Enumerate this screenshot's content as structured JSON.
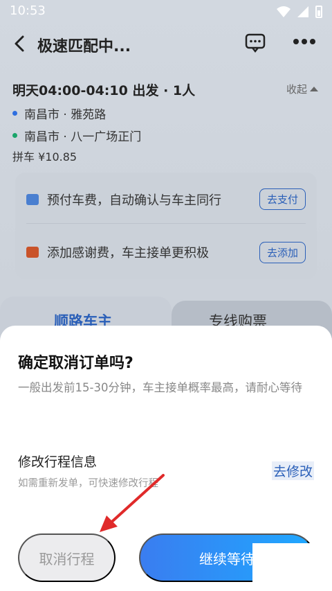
{
  "status": {
    "time": "10:53"
  },
  "nav": {
    "title": "极速匹配中..."
  },
  "trip": {
    "time_text": "明天04:00-04:10 出发 · 1人",
    "collapse_label": "收起",
    "origin": "南昌市 · 雅苑路",
    "destination": "南昌市 · 八一广场正门",
    "price": "拼车   ¥10.85"
  },
  "card": {
    "prepay_text": "预付车费，自动确认与车主同行",
    "prepay_button": "去支付",
    "tip_text": "添加感谢费，车主接单更积极",
    "tip_button": "去添加"
  },
  "tabs": {
    "active": "顺路车主",
    "other": "专线购票"
  },
  "sheet": {
    "title": "确定取消订单吗?",
    "description": "一般出发前15-30分钟，车主接单概率最高，请耐心等待",
    "edit_title": "修改行程信息",
    "edit_subtitle": "如需重新发单，可快速修改行程",
    "edit_link": "去修改",
    "cancel_button": "取消行程",
    "continue_button": "继续等待"
  },
  "colors": {
    "accent": "#2a5fb8",
    "arrow": "#e02a2a"
  }
}
